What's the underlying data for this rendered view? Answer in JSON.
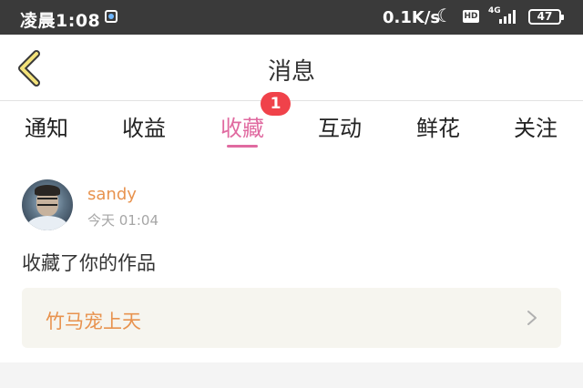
{
  "status_bar": {
    "time": "凌晨1:08",
    "net_speed": "0.1K/s",
    "hd_label": "HD",
    "network_type": "4G",
    "battery": "47"
  },
  "header": {
    "title": "消息"
  },
  "tabs": [
    {
      "label": "通知"
    },
    {
      "label": "收益"
    },
    {
      "label": "收藏",
      "active": true,
      "badge": "1"
    },
    {
      "label": "互动"
    },
    {
      "label": "鲜花"
    },
    {
      "label": "关注"
    }
  ],
  "colors": {
    "accent_pink": "#e06aa0",
    "username_orange": "#e8934f",
    "badge_red": "#f0424a",
    "card_bg": "#f6f5ef"
  },
  "message": {
    "username": "sandy",
    "time": "今天 01:04",
    "text": "收藏了你的作品",
    "work_title": "竹马宠上天"
  }
}
